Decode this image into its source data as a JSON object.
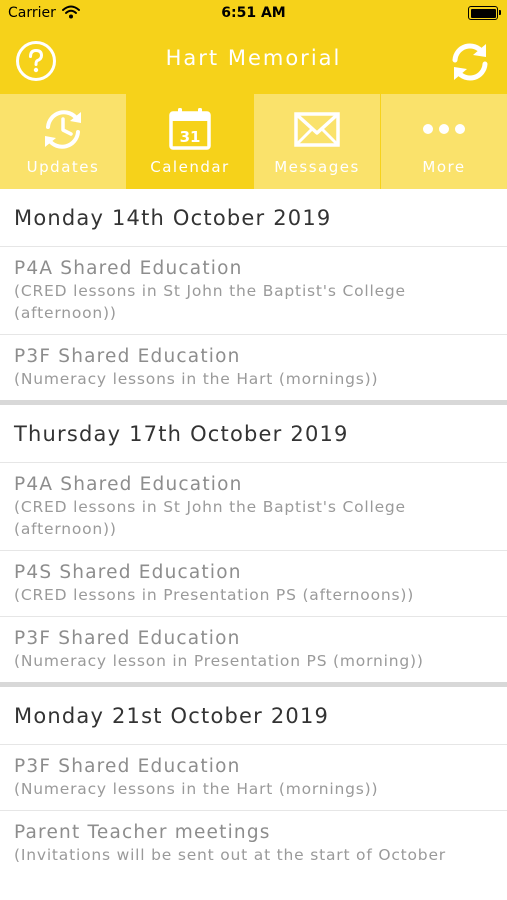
{
  "status_bar": {
    "carrier": "Carrier",
    "time": "6:51 AM"
  },
  "header": {
    "title": "Hart Memorial",
    "help_icon": "question-circle-icon",
    "refresh_icon": "refresh-icon"
  },
  "tabs": [
    {
      "label": "Updates",
      "icon": "clock-refresh-icon",
      "active": false
    },
    {
      "label": "Calendar",
      "icon": "calendar-icon",
      "active": true,
      "icon_text": "31"
    },
    {
      "label": "Messages",
      "icon": "envelope-icon",
      "active": false
    },
    {
      "label": "More",
      "icon": "more-dots-icon",
      "active": false
    }
  ],
  "days": [
    {
      "date": "Monday 14th October 2019",
      "events": [
        {
          "title": "P4A Shared Education",
          "description": "(CRED lessons in St John the Baptist's College (afternoon))"
        },
        {
          "title": "P3F Shared Education",
          "description": "(Numeracy lessons in the Hart (mornings))"
        }
      ]
    },
    {
      "date": "Thursday 17th October 2019",
      "events": [
        {
          "title": "P4A Shared Education",
          "description": "(CRED lessons in St John the Baptist's College (afternoon))"
        },
        {
          "title": "P4S Shared Education",
          "description": "(CRED lessons in Presentation PS (afternoons))"
        },
        {
          "title": "P3F Shared Education",
          "description": "(Numeracy lesson in Presentation PS (morning))"
        }
      ]
    },
    {
      "date": "Monday 21st October 2019",
      "events": [
        {
          "title": "P3F Shared Education",
          "description": "(Numeracy lessons in the Hart (mornings))"
        },
        {
          "title": "Parent Teacher meetings",
          "description": "(Invitations will be sent out at the start of October"
        }
      ]
    }
  ],
  "colors": {
    "brand_yellow": "#f6d21a",
    "tab_light_yellow": "#fae26b",
    "day_separator": "#d8d8d8"
  }
}
